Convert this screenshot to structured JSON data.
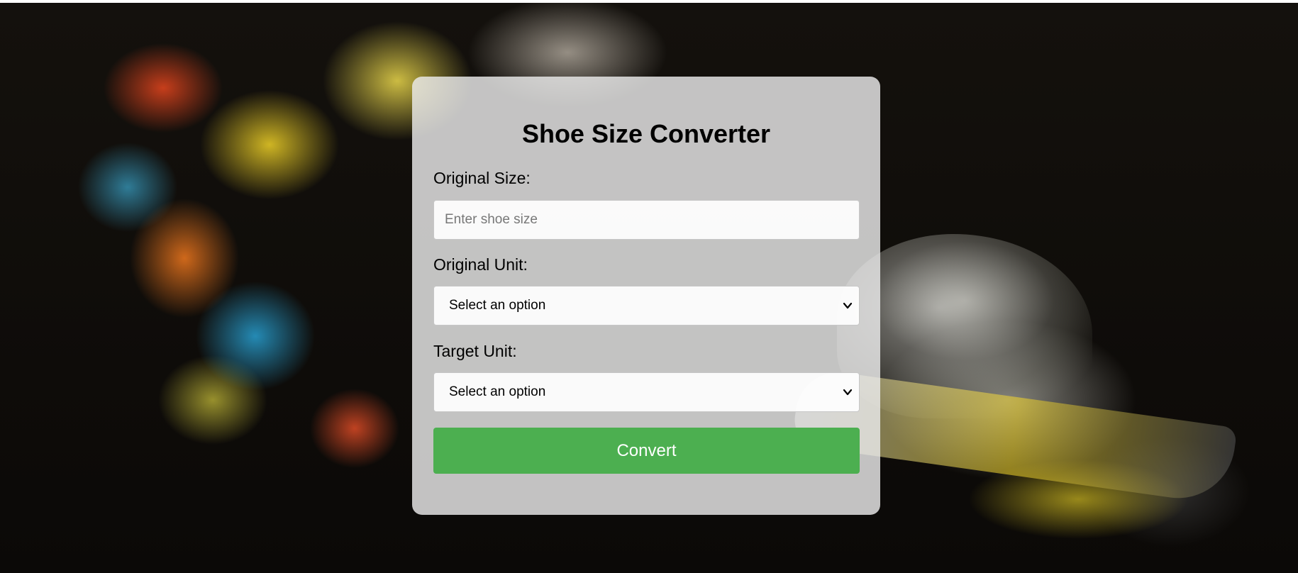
{
  "form": {
    "title": "Shoe Size Converter",
    "original_size_label": "Original Size:",
    "original_size_placeholder": "Enter shoe size",
    "original_size_value": "",
    "original_unit_label": "Original Unit:",
    "original_unit_selected": "Select an option",
    "target_unit_label": "Target Unit:",
    "target_unit_selected": "Select an option",
    "convert_label": "Convert"
  },
  "colors": {
    "accent": "#4caf50",
    "card_background": "#ececec",
    "page_background": "#0e0b08"
  },
  "icons": {
    "select_arrow": "chevron-down-icon"
  }
}
